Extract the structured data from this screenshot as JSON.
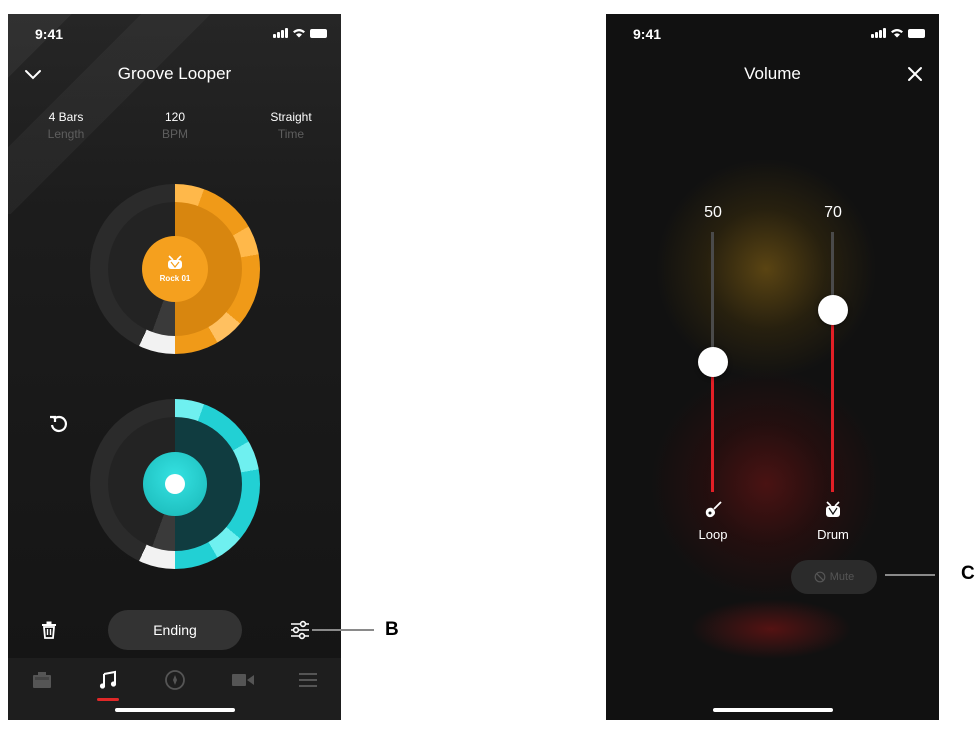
{
  "left_screen": {
    "status_time": "9:41",
    "title": "Groove Looper",
    "info": [
      {
        "value": "4 Bars",
        "label": "Length"
      },
      {
        "value": "120",
        "label": "BPM"
      },
      {
        "value": "Straight",
        "label": "Time"
      }
    ],
    "drum_pad_label": "Rock 01",
    "ending_button": "Ending",
    "tabs": [
      "amp-icon",
      "music-note-icon",
      "compass-icon",
      "video-icon",
      "menu-icon"
    ],
    "active_tab_index": 1,
    "colors": {
      "orange": "#f5a01e",
      "cyan": "#29dcdc",
      "red": "#e02828"
    }
  },
  "right_screen": {
    "status_time": "9:41",
    "title": "Volume",
    "channels": [
      {
        "name": "Loop",
        "value": "50",
        "level": 0.5,
        "icon": "guitar-icon"
      },
      {
        "name": "Drum",
        "value": "70",
        "level": 0.7,
        "icon": "drum-icon"
      }
    ],
    "mute_button": "Mute"
  },
  "callouts": {
    "b": "B",
    "c": "C"
  }
}
